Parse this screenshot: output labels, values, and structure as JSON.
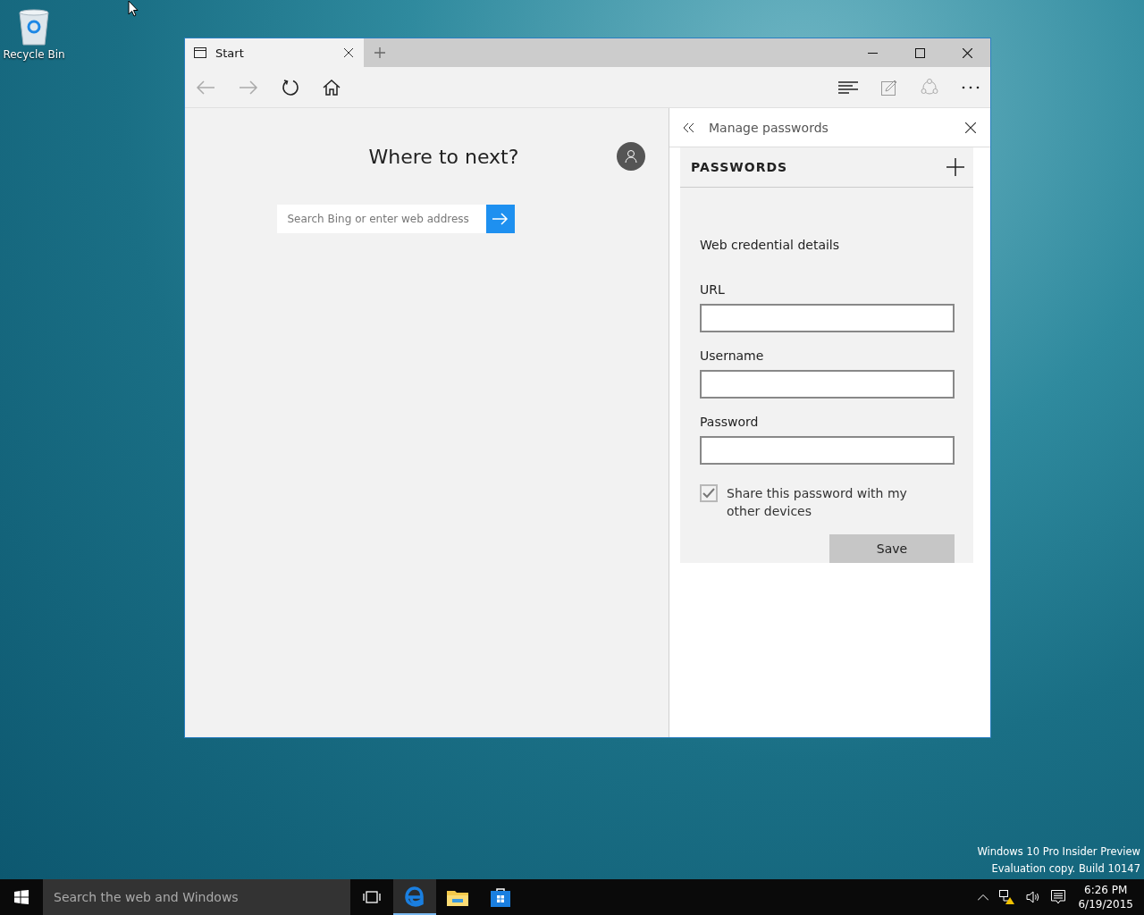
{
  "desktop": {
    "icons": [
      {
        "label": "Recycle Bin"
      }
    ],
    "watermark": [
      "Windows 10 Pro Insider Preview",
      "Evaluation copy. Build 10147"
    ]
  },
  "browser": {
    "tabs": [
      {
        "title": "Start",
        "selected": true
      }
    ],
    "toolbar": {
      "back": {
        "disabled": true
      },
      "forward": {
        "disabled": true
      }
    },
    "start_page": {
      "heading": "Where to next?",
      "search": {
        "placeholder": "Search Bing or enter web address"
      }
    },
    "panel": {
      "title": "Manage passwords",
      "section": "PASSWORDS",
      "subtitle": "Web credential details",
      "fields": [
        {
          "label": "URL"
        },
        {
          "label": "Username"
        },
        {
          "label": "Password"
        }
      ],
      "share": {
        "label": "Share this password with my other devices",
        "checked": true,
        "disabled": true
      },
      "save_button": "Save"
    }
  },
  "taskbar": {
    "search": {
      "placeholder": "Search the web and Windows"
    },
    "apps": [
      {
        "kind": "task-view",
        "selected": false
      },
      {
        "kind": "edge",
        "selected": true
      },
      {
        "kind": "explorer",
        "selected": false
      },
      {
        "kind": "store",
        "selected": false
      }
    ],
    "clock": {
      "time": "6:26 PM",
      "date": "6/19/2015"
    }
  }
}
